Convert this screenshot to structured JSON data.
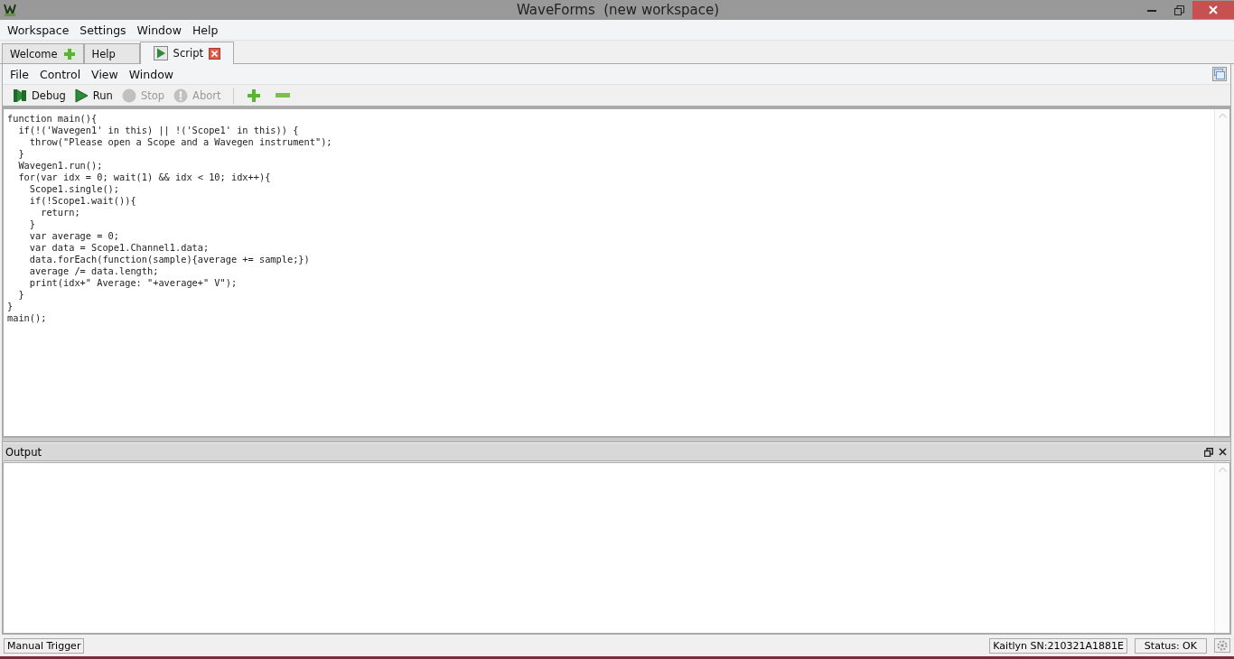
{
  "window": {
    "title": "WaveForms  (new workspace)"
  },
  "menu": [
    "Workspace",
    "Settings",
    "Window",
    "Help"
  ],
  "tabs": [
    {
      "label": "Welcome",
      "selected": false
    },
    {
      "label": "Help",
      "selected": false
    },
    {
      "label": "Script",
      "selected": true
    }
  ],
  "script_menu": [
    "File",
    "Control",
    "View",
    "Window"
  ],
  "toolbar": [
    {
      "label": "Debug",
      "disabled": false
    },
    {
      "label": "Run",
      "disabled": false
    },
    {
      "label": "Stop",
      "disabled": true
    },
    {
      "label": "Abort",
      "disabled": true
    },
    {
      "disabled": false
    },
    {
      "disabled": false
    }
  ],
  "code": [
    "function main(){",
    "  if(!('Wavegen1' in this) || !('Scope1' in this)) {",
    "    throw(\"Please open a Scope and a Wavegen instrument\");",
    "  }",
    "  Wavegen1.run();",
    "  for(var idx = 0; wait(1) && idx < 10; idx++){",
    "    Scope1.single();",
    "    if(!Scope1.wait()){",
    "      return;",
    "    }",
    "    var average = 0;",
    "    var data = Scope1.Channel1.data;",
    "    data.forEach(function(sample){average += sample;})",
    "    average /= data.length;",
    "    print(idx+\" Average: \"+average+\" V\");",
    "  }",
    "}",
    "main();"
  ],
  "output": {
    "title": "Output"
  },
  "status_bar": {
    "trigger": "Manual Trigger",
    "device": "Kaitlyn SN:210321A1881E",
    "status": "Status: OK"
  }
}
